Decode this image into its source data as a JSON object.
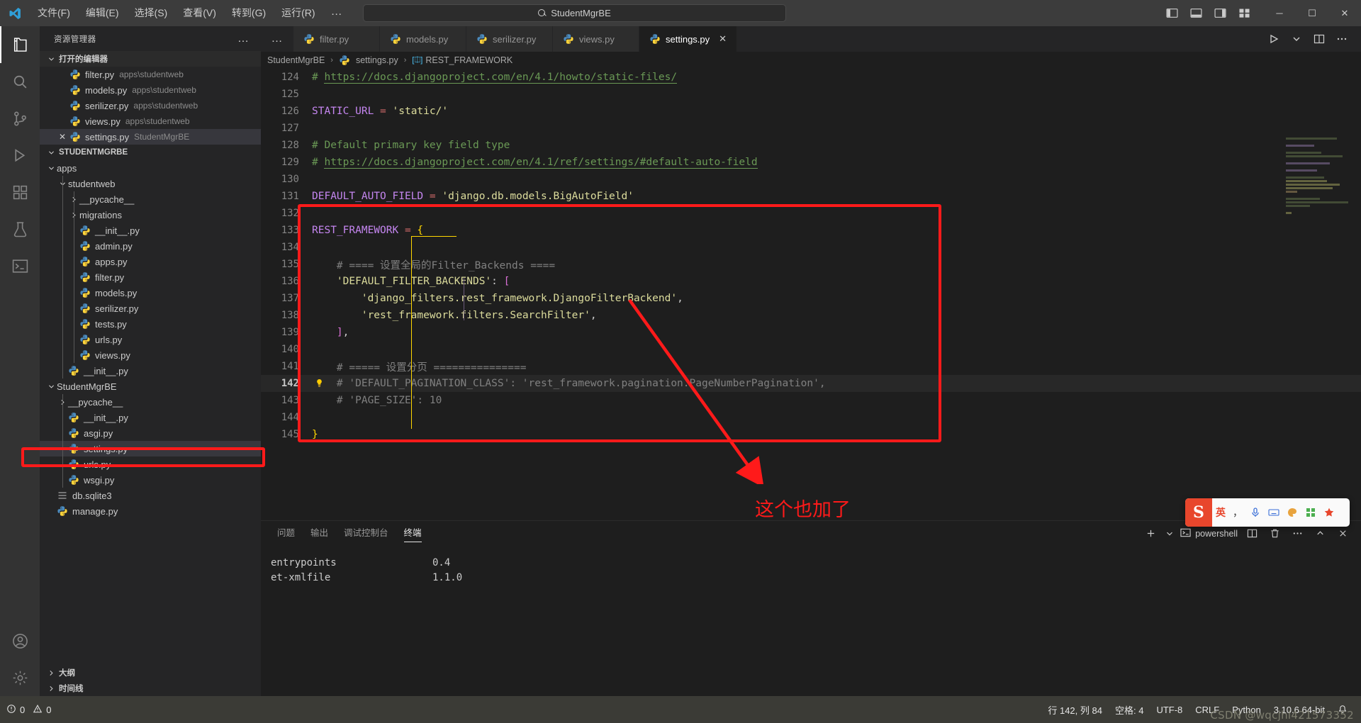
{
  "titlebar": {
    "menus": [
      "文件(F)",
      "编辑(E)",
      "选择(S)",
      "查看(V)",
      "转到(G)",
      "运行(R)"
    ],
    "more": "…",
    "search_value": "StudentMgrBE",
    "search_icon": "search-icon",
    "back_icon": "arrow-left-icon",
    "forward_icon": "arrow-right-icon",
    "minimize": "─",
    "maximize": "☐",
    "close": "✕"
  },
  "activitybar": {
    "items": [
      {
        "name": "explorer",
        "label": "资源管理器"
      },
      {
        "name": "search",
        "label": "搜索"
      },
      {
        "name": "source-control",
        "label": "源代码管理"
      },
      {
        "name": "run-debug",
        "label": "运行和调试"
      },
      {
        "name": "extensions",
        "label": "扩展"
      },
      {
        "name": "testing",
        "label": "测试"
      },
      {
        "name": "terminal",
        "label": "终端"
      }
    ],
    "bottom": [
      {
        "name": "account",
        "label": "账户"
      },
      {
        "name": "settings",
        "label": "管理"
      }
    ]
  },
  "sidebar": {
    "title": "资源管理器",
    "more": "…",
    "open_editors": {
      "label": "打开的编辑器",
      "items": [
        {
          "name": "filter.py",
          "path": "apps\\studentweb",
          "selected": false,
          "dirty": false
        },
        {
          "name": "models.py",
          "path": "apps\\studentweb",
          "selected": false,
          "dirty": false
        },
        {
          "name": "serilizer.py",
          "path": "apps\\studentweb",
          "selected": false,
          "dirty": false
        },
        {
          "name": "views.py",
          "path": "apps\\studentweb",
          "selected": false,
          "dirty": false
        },
        {
          "name": "settings.py",
          "path": "StudentMgrBE",
          "selected": true,
          "dirty": false
        }
      ]
    },
    "project": {
      "label": "STUDENTMGRBE",
      "tree": [
        {
          "label": "apps",
          "type": "folder",
          "depth": 1,
          "expanded": true
        },
        {
          "label": "studentweb",
          "type": "folder",
          "depth": 2,
          "expanded": true
        },
        {
          "label": "__pycache__",
          "type": "folder",
          "depth": 3,
          "expanded": false
        },
        {
          "label": "migrations",
          "type": "folder",
          "depth": 3,
          "expanded": false
        },
        {
          "label": "__init__.py",
          "type": "py",
          "depth": 3
        },
        {
          "label": "admin.py",
          "type": "py",
          "depth": 3
        },
        {
          "label": "apps.py",
          "type": "py",
          "depth": 3
        },
        {
          "label": "filter.py",
          "type": "py",
          "depth": 3
        },
        {
          "label": "models.py",
          "type": "py",
          "depth": 3
        },
        {
          "label": "serilizer.py",
          "type": "py",
          "depth": 3
        },
        {
          "label": "tests.py",
          "type": "py",
          "depth": 3
        },
        {
          "label": "urls.py",
          "type": "py",
          "depth": 3
        },
        {
          "label": "views.py",
          "type": "py",
          "depth": 3
        },
        {
          "label": "__init__.py",
          "type": "py",
          "depth": 2
        },
        {
          "label": "StudentMgrBE",
          "type": "folder",
          "depth": 1,
          "expanded": true
        },
        {
          "label": "__pycache__",
          "type": "folder",
          "depth": 2,
          "expanded": false
        },
        {
          "label": "__init__.py",
          "type": "py",
          "depth": 2
        },
        {
          "label": "asgi.py",
          "type": "py",
          "depth": 2
        },
        {
          "label": "settings.py",
          "type": "py",
          "depth": 2,
          "selected": true
        },
        {
          "label": "urls.py",
          "type": "py",
          "depth": 2
        },
        {
          "label": "wsgi.py",
          "type": "py",
          "depth": 2
        },
        {
          "label": "db.sqlite3",
          "type": "db",
          "depth": 1
        },
        {
          "label": "manage.py",
          "type": "py",
          "depth": 1
        }
      ]
    },
    "outline": "大纲",
    "timeline": "时间线"
  },
  "tabs": {
    "more": "…",
    "items": [
      {
        "label": "filter.py",
        "active": false
      },
      {
        "label": "models.py",
        "active": false
      },
      {
        "label": "serilizer.py",
        "active": false
      },
      {
        "label": "views.py",
        "active": false
      },
      {
        "label": "settings.py",
        "active": true,
        "close": "✕"
      }
    ],
    "actions": [
      "run-icon",
      "chevron-down-icon",
      "split-editor-icon",
      "more-actions-icon"
    ]
  },
  "breadcrumb": {
    "root": "StudentMgrBE",
    "file": "settings.py",
    "symbol": "REST_FRAMEWORK",
    "separator": "›"
  },
  "code": {
    "first_line": 124,
    "active_line": 142,
    "lines": [
      {
        "n": 124,
        "tokens": [
          {
            "t": "# ",
            "c": "t-com"
          },
          {
            "t": "https://docs.djangoproject.com/en/4.1/howto/static-files/",
            "c": "t-link"
          }
        ],
        "indent": 0
      },
      {
        "n": 125,
        "tokens": [],
        "indent": 0
      },
      {
        "n": 126,
        "tokens": [
          {
            "t": "STATIC_URL",
            "c": "t-const"
          },
          {
            "t": " ",
            "c": ""
          },
          {
            "t": "=",
            "c": "t-op"
          },
          {
            "t": " ",
            "c": ""
          },
          {
            "t": "'static/'",
            "c": "t-str"
          }
        ],
        "indent": 0
      },
      {
        "n": 127,
        "tokens": [],
        "indent": 0
      },
      {
        "n": 128,
        "tokens": [
          {
            "t": "# Default primary key field type",
            "c": "t-com"
          }
        ],
        "indent": 0
      },
      {
        "n": 129,
        "tokens": [
          {
            "t": "# ",
            "c": "t-com"
          },
          {
            "t": "https://docs.djangoproject.com/en/4.1/ref/settings/#default-auto-field",
            "c": "t-link"
          }
        ],
        "indent": 0
      },
      {
        "n": 130,
        "tokens": [],
        "indent": 0
      },
      {
        "n": 131,
        "tokens": [
          {
            "t": "DEFAULT_AUTO_FIELD",
            "c": "t-const"
          },
          {
            "t": " ",
            "c": ""
          },
          {
            "t": "=",
            "c": "t-op"
          },
          {
            "t": " ",
            "c": ""
          },
          {
            "t": "'django.db.models.BigAutoField'",
            "c": "t-str"
          }
        ],
        "indent": 0
      },
      {
        "n": 132,
        "tokens": [],
        "indent": 0
      },
      {
        "n": 133,
        "tokens": [
          {
            "t": "REST_FRAMEWORK",
            "c": "t-const"
          },
          {
            "t": " ",
            "c": ""
          },
          {
            "t": "=",
            "c": "t-op"
          },
          {
            "t": " ",
            "c": ""
          },
          {
            "t": "{",
            "c": "t-br1"
          }
        ],
        "indent": 0
      },
      {
        "n": 134,
        "tokens": [],
        "indent": 0
      },
      {
        "n": 135,
        "tokens": [
          {
            "t": "    # ==== 设置全局的Filter_Backends ====",
            "c": "t-comg"
          }
        ],
        "indent": 1
      },
      {
        "n": 136,
        "tokens": [
          {
            "t": "    ",
            "c": ""
          },
          {
            "t": "'DEFAULT_FILTER_BACKENDS'",
            "c": "t-str"
          },
          {
            "t": ":",
            "c": ""
          },
          {
            "t": " ",
            "c": ""
          },
          {
            "t": "[",
            "c": "t-br2"
          }
        ],
        "indent": 1
      },
      {
        "n": 137,
        "tokens": [
          {
            "t": "        ",
            "c": ""
          },
          {
            "t": "'django_filters.rest_framework.DjangoFilterBackend'",
            "c": "t-str"
          },
          {
            "t": ",",
            "c": ""
          }
        ],
        "indent": 2
      },
      {
        "n": 138,
        "tokens": [
          {
            "t": "        ",
            "c": ""
          },
          {
            "t": "'rest_framework.filters.SearchFilter'",
            "c": "t-str"
          },
          {
            "t": ",",
            "c": ""
          }
        ],
        "indent": 2
      },
      {
        "n": 139,
        "tokens": [
          {
            "t": "    ",
            "c": ""
          },
          {
            "t": "]",
            "c": "t-br2"
          },
          {
            "t": ",",
            "c": ""
          }
        ],
        "indent": 1
      },
      {
        "n": 140,
        "tokens": [],
        "indent": 0
      },
      {
        "n": 141,
        "tokens": [
          {
            "t": "    # ===== 设置分页 ===============",
            "c": "t-comg"
          }
        ],
        "indent": 1
      },
      {
        "n": 142,
        "tokens": [
          {
            "t": "    # 'DEFAULT_PAGINATION_CLASS': 'rest_framework.pagination.PageNumberPagination',",
            "c": "t-comg"
          }
        ],
        "indent": 1,
        "active": true,
        "bulb": true
      },
      {
        "n": 143,
        "tokens": [
          {
            "t": "    # 'PAGE_SIZE': 10",
            "c": "t-comg"
          }
        ],
        "indent": 1
      },
      {
        "n": 144,
        "tokens": [],
        "indent": 0
      },
      {
        "n": 145,
        "tokens": [
          {
            "t": "}",
            "c": "t-br1"
          }
        ],
        "indent": 0
      }
    ]
  },
  "panel": {
    "tabs": [
      {
        "label": "问题",
        "active": false
      },
      {
        "label": "输出",
        "active": false
      },
      {
        "label": "调试控制台",
        "active": false
      },
      {
        "label": "终端",
        "active": true
      }
    ],
    "add_icon": "plus-icon",
    "add_chevron": "chevron-down-icon",
    "shell_icon": "terminal-icon",
    "shell_label": "powershell",
    "split_icon": "split-panel-icon",
    "kill_icon": "trash-icon",
    "more_icon": "more-actions-icon",
    "maximize_icon": "chevron-up-icon",
    "close_icon": "close-icon",
    "terminal_lines": [
      {
        "name": "entrypoints",
        "version": "0.4"
      },
      {
        "name": "et-xmlfile",
        "version": "1.1.0"
      }
    ]
  },
  "statusbar": {
    "errors_icon": "error-icon",
    "errors": "0",
    "warnings_icon": "warning-icon",
    "warnings": "0",
    "position": "行 142, 列 84",
    "spaces": "空格: 4",
    "encoding": "UTF-8",
    "eol": "CRLF",
    "language": "Python",
    "interpreter": "3.10.6 64-bit",
    "bell_icon": "bell-icon"
  },
  "ime": {
    "logo": "S",
    "mode": "英",
    "items": [
      "comma-icon",
      "mic-icon",
      "keyboard-icon",
      "palette-icon",
      "grid-icon",
      "star-icon"
    ]
  },
  "annotations": {
    "code_box": "REST_FRAMEWORK block highlight",
    "file_box": "settings.py highlight",
    "arrow": "red-arrow",
    "note": "这个也加了"
  },
  "watermark": "CSDN @wqcjhl421573352",
  "colors": {
    "annotation_red": "#ff1a1a",
    "accent_blue": "#0078d4",
    "status_bg": "#3b3b36",
    "editor_bg": "#1e1e1e",
    "sidebar_bg": "#252526",
    "activity_bg": "#333333",
    "title_bg": "#3c3c3c"
  }
}
